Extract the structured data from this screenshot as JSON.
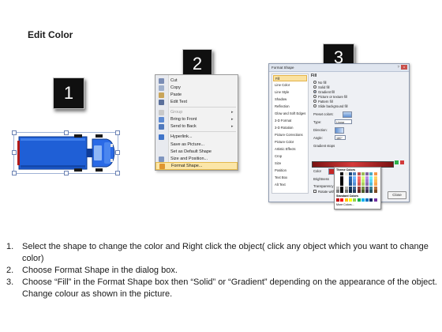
{
  "title": "Edit Color",
  "badges": [
    "1",
    "2",
    "3"
  ],
  "context_menu": {
    "items": [
      {
        "label": "Cut",
        "underline": "t",
        "dim": false,
        "submenu": false,
        "icon": "scissors-icon"
      },
      {
        "label": "Copy",
        "dim": false,
        "submenu": false,
        "icon": "copy-icon"
      },
      {
        "label": "Paste",
        "dim": false,
        "submenu": false,
        "icon": "paste-icon"
      },
      {
        "label": "Edit Text",
        "dim": false,
        "submenu": false,
        "icon": "edit-text-icon"
      },
      {
        "label": "Group",
        "dim": true,
        "submenu": true,
        "icon": "group-icon"
      },
      {
        "label": "Bring to Front",
        "dim": false,
        "submenu": true,
        "icon": "bring-front-icon"
      },
      {
        "label": "Send to Back",
        "dim": false,
        "submenu": true,
        "icon": "send-back-icon"
      },
      {
        "label": "Hyperlink...",
        "dim": false,
        "submenu": false,
        "icon": "hyperlink-icon"
      },
      {
        "label": "Save as Picture...",
        "dim": false,
        "submenu": false,
        "icon": ""
      },
      {
        "label": "Set as Default Shape",
        "dim": false,
        "submenu": false,
        "icon": ""
      },
      {
        "label": "Size and Position...",
        "dim": false,
        "submenu": false,
        "icon": "size-position-icon"
      },
      {
        "label": "Format Shape...",
        "dim": false,
        "submenu": false,
        "icon": "format-shape-icon",
        "highlighted": true
      }
    ]
  },
  "dialog": {
    "title": "Format Shape",
    "help": "?",
    "close_x": "x",
    "categories": [
      "Fill",
      "Line Color",
      "Line Style",
      "Shadow",
      "Reflection",
      "Glow and Soft Edges",
      "3-D Format",
      "3-D Rotation",
      "Picture Corrections",
      "Picture Color",
      "Artistic Effects",
      "Crop",
      "Size",
      "Position",
      "Text Box",
      "Alt Text"
    ],
    "selected_category": "Fill",
    "fill_heading": "Fill",
    "fill_options": [
      "No fill",
      "Solid fill",
      "Gradient fill",
      "Picture or texture fill",
      "Pattern fill",
      "Slide background fill"
    ],
    "selected_fill": "Gradient fill",
    "preset_label": "Preset colors:",
    "type_label": "Type:",
    "type_value": "Linear",
    "direction_label": "Direction:",
    "angle_label": "Angle:",
    "angle_value": "180°",
    "gradient_stops_label": "Gradient stops",
    "color_label": "Color",
    "position_label": "Position:",
    "position_value": "90%",
    "brightness_label": "Brightness",
    "transparency_label": "Transparency",
    "rotate_label": "Rotate with shape",
    "palette_theme_label": "Theme Colors",
    "palette_standard_label": "Standard Colors",
    "palette_more_label": "More Colors...",
    "close_label": "Close"
  },
  "instructions": [
    {
      "num": "1.",
      "text": "Select the shape to change the color and Right click the object( click any object which you want to change color)"
    },
    {
      "num": "2.",
      "text": "Choose Format Shape in the dialog box."
    },
    {
      "num": "3.",
      "text": "Choose “Fill” in the Format Shape box then “Solid” or “Gradient” depending on the appearance of the object. Change colour as shown in the picture."
    }
  ],
  "colors": {
    "truck_body": "#1f5fd6",
    "truck_cab": "#2a6ae6",
    "menu_highlight": "#fbe6a8",
    "gradient_red": "#c62828",
    "badge_bg": "#101010"
  }
}
